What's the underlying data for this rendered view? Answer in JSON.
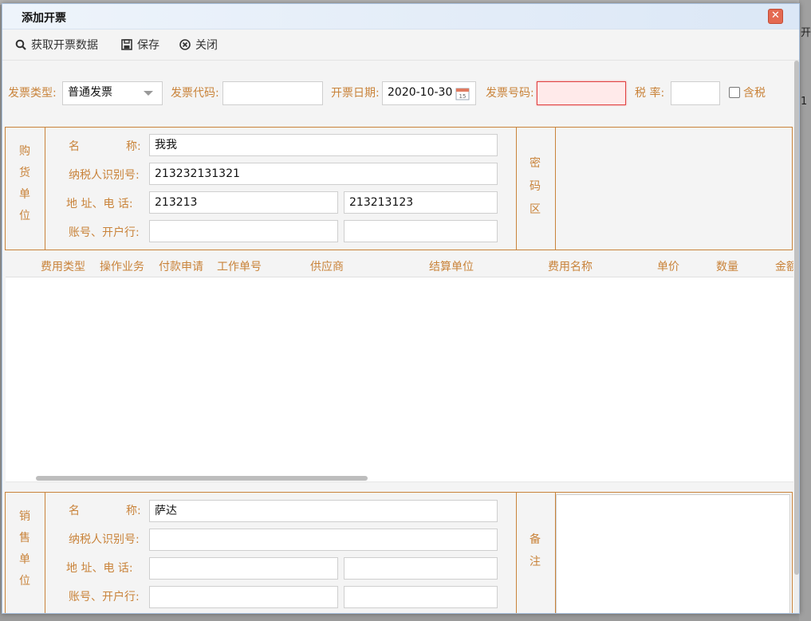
{
  "dialog": {
    "title": "添加开票",
    "close_label": "✕"
  },
  "toolbar": {
    "fetch_label": "获取开票数据",
    "save_label": "保存",
    "close_label": "关闭"
  },
  "invoice": {
    "type_label": "发票类型:",
    "type_value": "普通发票",
    "code_label": "发票代码:",
    "code_value": "",
    "date_label": "开票日期:",
    "date_value": "2020-10-30",
    "number_label": "发票号码:",
    "number_value": "",
    "tax_rate_label": "税  率:",
    "tax_rate_value": "",
    "tax_included_label": "含税"
  },
  "buyer": {
    "section_label": [
      "购",
      "货",
      "单",
      "位"
    ],
    "name_label": "名      称:",
    "name_value": "我我",
    "tax_id_label": "纳税人识别号:",
    "tax_id_value": "213232131321",
    "address_label": "地  址、电  话:",
    "address_value": "213213",
    "phone_value": "213213123",
    "account_label": "账号、开户行:",
    "account_value": "",
    "bank_value": "",
    "cipher_label": [
      "密",
      "码",
      "区"
    ]
  },
  "grid": {
    "columns": [
      "费用类型",
      "操作业务",
      "付款申请",
      "工作单号",
      "供应商",
      "结算单位",
      "费用名称",
      "单价",
      "数量",
      "金额"
    ]
  },
  "seller": {
    "section_label": [
      "销",
      "售",
      "单",
      "位"
    ],
    "name_label": "名      称:",
    "name_value": "萨达",
    "tax_id_label": "纳税人识别号:",
    "tax_id_value": "",
    "address_label": "地  址、电  话:",
    "address_value": "",
    "phone_value": "",
    "account_label": "账号、开户行:",
    "account_value": "",
    "bank_value": "",
    "remark_label": [
      "备",
      "注"
    ]
  },
  "background": {
    "right_cells": [
      "开",
      "1"
    ]
  }
}
